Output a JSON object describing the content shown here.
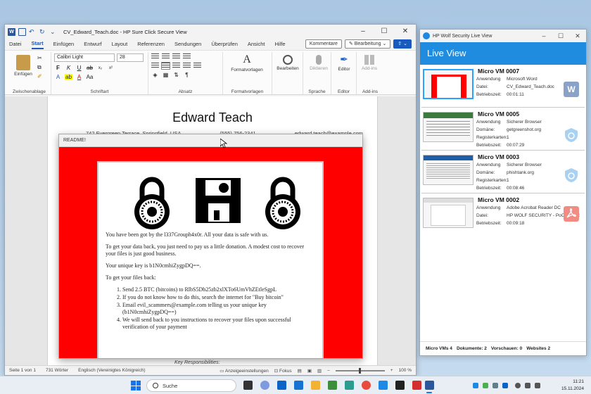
{
  "word": {
    "title": "CV_Edward_Teach.doc - HP Sure Click Secure View",
    "tabs": [
      "Datei",
      "Start",
      "Einfügen",
      "Entwurf",
      "Layout",
      "Referenzen",
      "Sendungen",
      "Überprüfen",
      "Ansicht",
      "Hilfe"
    ],
    "comments_label": "Kommentare",
    "edit_label": "Bearbeitung",
    "ribbon": {
      "paste_label": "Einfügen",
      "clipboard_group": "Zwischenablage",
      "font_name": "Calibri Light",
      "font_size": "28",
      "font_group": "Schriftart",
      "paragraph_group": "Absatz",
      "styles_label": "Formatvorlagen",
      "styles_group": "Formatvorlagen",
      "edit_btn": "Bearbeiten",
      "dictate_label": "Diktieren",
      "voice_group": "Sprache",
      "editor_label": "Editor",
      "editor_group": "Editor",
      "addins_label": "Add-ins",
      "addins_group": "Add-ins"
    },
    "doc": {
      "name": "Edward Teach",
      "address": "742 Evergreen Terrace, Springfield, USA",
      "phone": "(555) 756-2341",
      "email": "edward.teach@example.com",
      "footer_heading": "Key Responsibilities:"
    },
    "status": {
      "page": "Seite 1 von 1",
      "words": "731 Wörter",
      "language": "Englisch (Vereinigtes Königreich)",
      "display_settings": "Anzeigeeinstellungen",
      "focus": "Fokus",
      "zoom": "100 %"
    }
  },
  "readme": {
    "title": "README!",
    "para1": "You have been got by the l337Grouph4x0r. All your data is safe with us.",
    "para2": "To get your data back, you just need to pay us a little donation. A modest cost to recover your files is just good business.",
    "para3": "Your unique key is b1N0cmhiZygpDQ==.",
    "para4": "To get your files back:",
    "steps": [
      "Send 2.5 BTC (bitcoins) to RlbS5Db25zb2xlXTo6UmVhZEtleSgpL",
      "If you do not know how to do this, search the internet for \"Buy bitcoin\"",
      "Email evil_scammers@example.com telling us your unique key (b1N0cmhiZygpDQ==)",
      "We will send back to you instructions to recover your files upon successful verification of your payment"
    ]
  },
  "live_view": {
    "window_title": "HP Wolf Security Live View",
    "header": "Live View",
    "vms": [
      {
        "name": "Micro VM 0007",
        "rows": [
          {
            "key": "Anwendung",
            "value": "Microsoft Word"
          },
          {
            "key": "Datei:",
            "value": "CV_Edward_Teach.doc"
          },
          {
            "key": "Betriebszeit:",
            "value": "00:01:11"
          }
        ],
        "app_icon": "word-icon"
      },
      {
        "name": "Micro VM 0005",
        "rows": [
          {
            "key": "Anwendung",
            "value": "Sicherer Browser"
          },
          {
            "key": "Domäne:",
            "value": "getgreenshot.org"
          },
          {
            "key": "Registerkarten:",
            "value": "1"
          },
          {
            "key": "Betriebszeit:",
            "value": "00:07:29"
          }
        ],
        "app_icon": "secure-browser-icon"
      },
      {
        "name": "Micro VM 0003",
        "rows": [
          {
            "key": "Anwendung",
            "value": "Sicherer Browser"
          },
          {
            "key": "Domäne:",
            "value": "phishtank.org"
          },
          {
            "key": "Registerkarten:",
            "value": "1"
          },
          {
            "key": "Betriebszeit:",
            "value": "00:08:46"
          }
        ],
        "app_icon": "secure-browser-icon"
      },
      {
        "name": "Micro VM 0002",
        "rows": [
          {
            "key": "Anwendung",
            "value": "Adobe Acrobat Reader DC"
          },
          {
            "key": "Datei:",
            "value": "HP WOLF SECURITY - PoC Task C"
          },
          {
            "key": "Betriebszeit:",
            "value": "00:09:18"
          }
        ],
        "app_icon": "acrobat-icon"
      }
    ],
    "status": {
      "micro_vms": "Micro VMs 4",
      "documents": "Dokumente: 2",
      "previews": "Vorschauen: 0",
      "websites": "Websites 2"
    }
  },
  "taskbar": {
    "search_placeholder": "Suche",
    "time": "11:21",
    "date": "15.11.2024"
  },
  "colors": {
    "word_blue": "#185abd",
    "ransom_red": "#ff0000",
    "hp_blue": "#1f8ce0"
  }
}
